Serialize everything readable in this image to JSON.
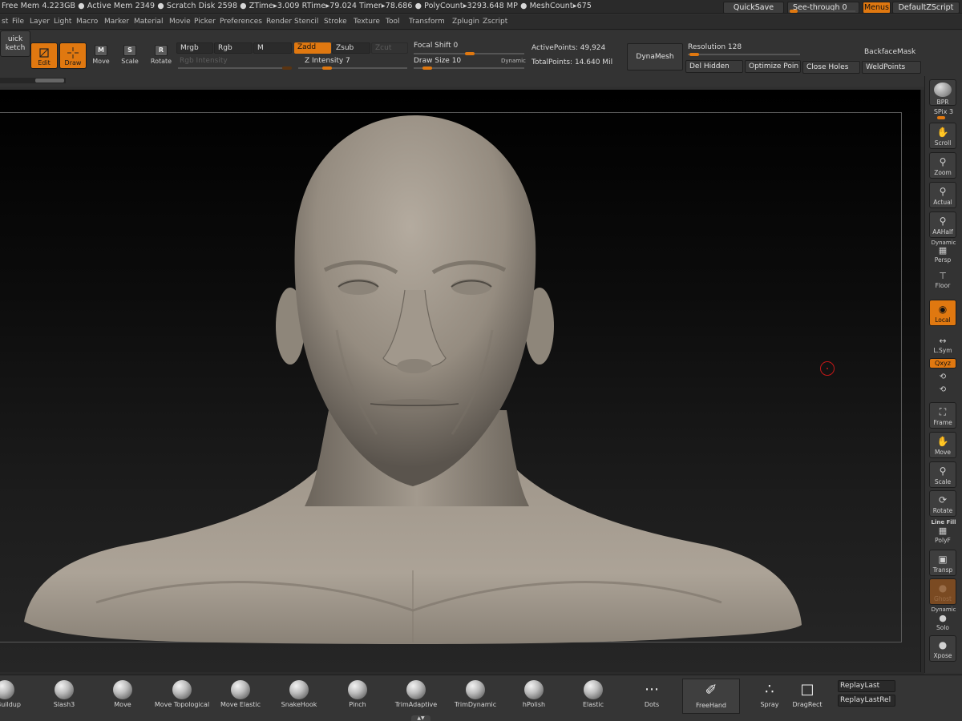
{
  "statusbar": {
    "text": "Free Mem 4.223GB ● Active Mem 2349 ● Scratch Disk 2598 ● ZTime▸3.009 RTime▸79.024 Timer▸78.686 ● PolyCount▸3293.648 MP ● MeshCount▸675",
    "quicksave": "QuickSave",
    "see_through": "See-through  0",
    "menus": "Menus",
    "default_zscript": "DefaultZScript"
  },
  "menubar": [
    "st",
    "File",
    "Layer",
    "Light",
    "Macro",
    "Marker",
    "Material",
    "Movie",
    "Picker",
    "Preferences",
    "Render",
    "Stencil",
    "Stroke",
    "Texture",
    "Tool",
    "Transform",
    "Zplugin",
    "Zscript"
  ],
  "shelf": {
    "quick_sketch": [
      "uick",
      "ketch"
    ],
    "edit": "Edit",
    "draw": "Draw",
    "move": "Move",
    "scale": "Scale",
    "rotate": "Rotate",
    "mrgb": "Mrgb",
    "rgb": "Rgb",
    "m": "M",
    "rgb_intensity": "Rgb  Intensity",
    "zadd": "Zadd",
    "zsub": "Zsub",
    "zcut": "Zcut",
    "z_intensity": "Z Intensity 7",
    "focal_shift": "Focal Shift 0",
    "draw_size": "Draw Size 10",
    "dynamic": "Dynamic",
    "active_points": "ActivePoints: 49,924",
    "total_points": "TotalPoints: 14.640 Mil",
    "dynamesh": "DynaMesh",
    "resolution": "Resolution 128",
    "del_hidden": "Del Hidden",
    "optimize_points": "Optimize Poin",
    "close_holes": "Close Holes",
    "backface_mask": "BackfaceMask",
    "weld_points": "WeldPoints"
  },
  "right_shelf": {
    "bpr": "BPR",
    "spix": "SPix 3",
    "scroll": "Scroll",
    "zoom": "Zoom",
    "actual": "Actual",
    "aahalf": "AAHalf",
    "dynamic": "Dynamic",
    "persp": "Persp",
    "floor": "Floor",
    "local": "Local",
    "lsym": "L.Sym",
    "xyz": "Qxyz",
    "frame": "Frame",
    "move": "Move",
    "scale": "Scale",
    "rotate": "Rotate",
    "line_fill": "Line Fill",
    "polyf": "PolyF",
    "transp": "Transp",
    "ghost": "Ghost",
    "dynamic2": "Dynamic",
    "solo": "Solo",
    "xpose": "Xpose"
  },
  "brushes": [
    {
      "label": "ayBuildup"
    },
    {
      "label": "Slash3"
    },
    {
      "label": "Move"
    },
    {
      "label": "Move Topological"
    },
    {
      "label": "Move Elastic"
    },
    {
      "label": "SnakeHook"
    },
    {
      "label": "Pinch"
    },
    {
      "label": "TrimAdaptive"
    },
    {
      "label": "TrimDynamic"
    },
    {
      "label": "hPolish"
    },
    {
      "label": "Elastic"
    },
    {
      "label": "Dots"
    },
    {
      "label": "FreeHand"
    },
    {
      "label": "Spray"
    },
    {
      "label": "DragRect"
    }
  ],
  "replay": {
    "last": "ReplayLast",
    "last_rel": "ReplayLastRel"
  },
  "icons": [
    "edit-icon",
    "draw-icon",
    "move-icon",
    "scale-icon",
    "rotate-icon",
    "scroll-icon",
    "zoom-icon",
    "actual-icon",
    "aahalf-icon",
    "persp-icon",
    "floor-icon",
    "local-icon",
    "lsym-icon",
    "frame-icon",
    "polyf-icon",
    "transp-icon",
    "ghost-icon",
    "solo-icon",
    "xpose-icon"
  ],
  "colors": {
    "accent": "#e07810",
    "panel": "#333333",
    "cursor": "#c41818",
    "clay": "#a89f94"
  }
}
